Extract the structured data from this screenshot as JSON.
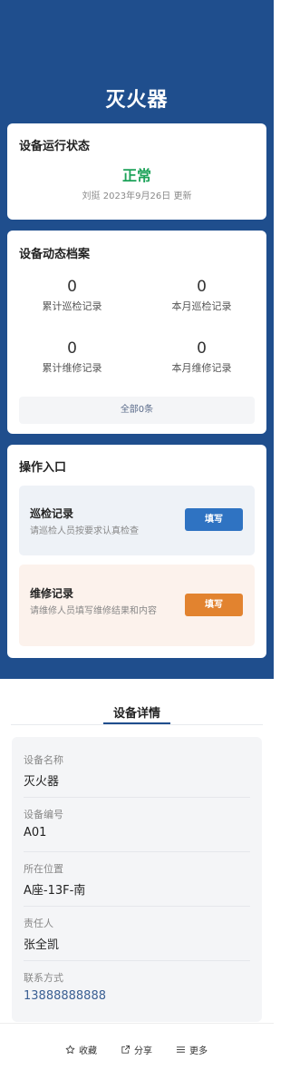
{
  "page": {
    "title": "灭火器"
  },
  "status_card": {
    "title": "设备运行状态",
    "status": "正常",
    "meta": "刘挺 2023年9月26日 更新"
  },
  "archive_card": {
    "title": "设备动态档案",
    "stats": [
      {
        "value": "0",
        "label": "累计巡检记录"
      },
      {
        "value": "0",
        "label": "本月巡检记录"
      },
      {
        "value": "0",
        "label": "累计维修记录"
      },
      {
        "value": "0",
        "label": "本月维修记录"
      }
    ],
    "all_label": "全部0条"
  },
  "ops_card": {
    "title": "操作入口",
    "items": [
      {
        "name": "巡检记录",
        "desc": "请巡检人员按要求认真检查",
        "button": "填写"
      },
      {
        "name": "维修记录",
        "desc": "请维修人员填写维修结果和内容",
        "button": "填写"
      }
    ]
  },
  "details": {
    "tab": "设备详情",
    "fields": [
      {
        "label": "设备名称",
        "value": "灭火器"
      },
      {
        "label": "设备编号",
        "value": "A01"
      },
      {
        "label": "所在位置",
        "value": "A座-13F-南"
      },
      {
        "label": "责任人",
        "value": "张全凯"
      },
      {
        "label": "联系方式",
        "value": "13888888888"
      }
    ]
  },
  "footer": {
    "favorite": "收藏",
    "share": "分享",
    "more": "更多"
  },
  "colors": {
    "hero": "#1f4e8d",
    "status_ok": "#1ea35a",
    "inspect_button": "#2f73c2",
    "inspect_bg": "#eef2f7",
    "repair_button": "#e2832f",
    "repair_bg": "#fcf2ec"
  },
  "icons": {
    "favorite": "star-icon",
    "share": "share-icon",
    "more": "menu-icon"
  }
}
